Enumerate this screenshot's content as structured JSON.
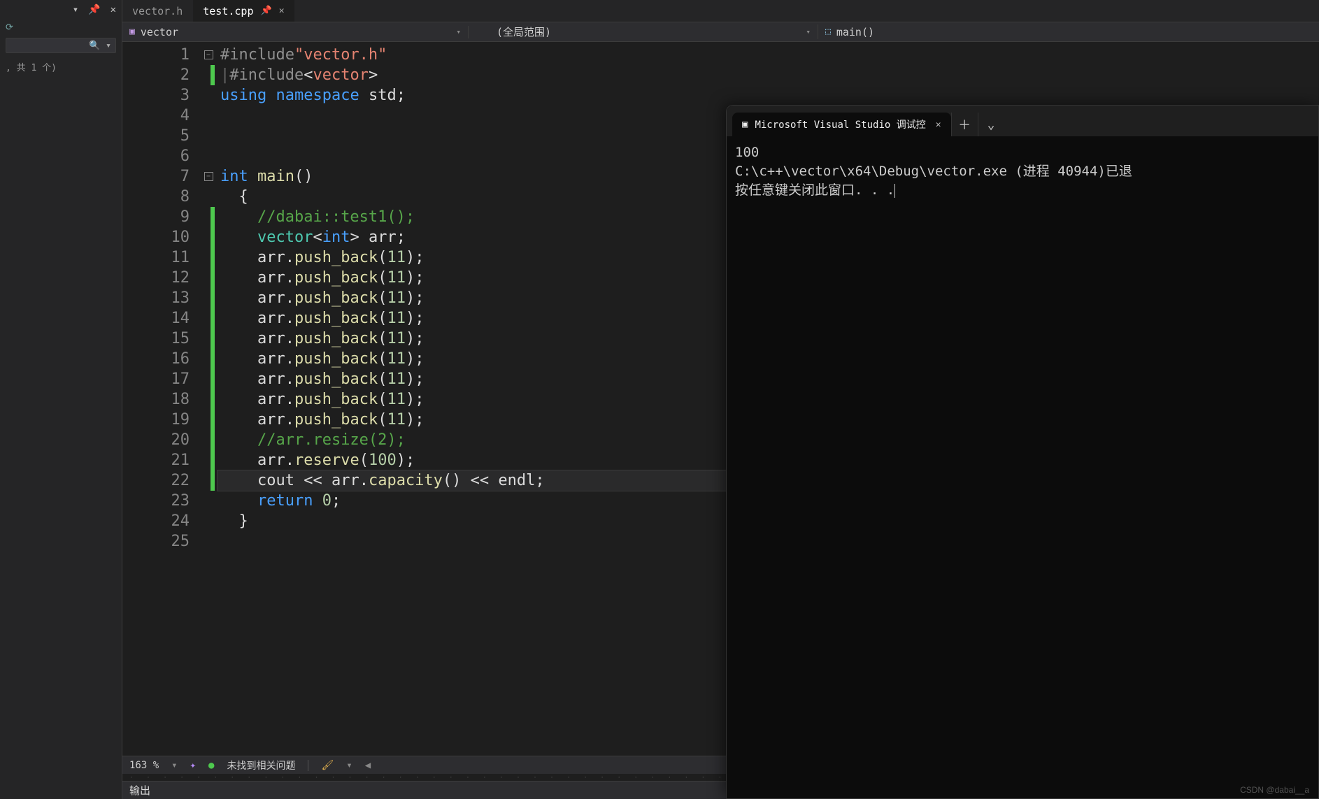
{
  "left_panel": {
    "hint": ", 共 1 个)",
    "top_icons": [
      "chev-down",
      "pin",
      "close"
    ]
  },
  "tabs": [
    {
      "label": "vector.h",
      "active": false
    },
    {
      "label": "test.cpp",
      "active": true
    }
  ],
  "nav": {
    "left": "vector",
    "middle": "(全局范围)",
    "right": "main()"
  },
  "code": {
    "lines": [
      {
        "n": 1,
        "fold": true,
        "green": false,
        "tokens": [
          [
            "pre",
            "#include"
          ],
          [
            "str",
            "\"vector.h\""
          ]
        ]
      },
      {
        "n": 2,
        "fold": false,
        "green": true,
        "tokens": [
          [
            "plainbar",
            "|"
          ],
          [
            "pre",
            "#include"
          ],
          [
            "punct",
            "<"
          ],
          [
            "str",
            "vector"
          ],
          [
            "punct",
            ">"
          ]
        ]
      },
      {
        "n": 3,
        "fold": false,
        "green": false,
        "tokens": [
          [
            "kw",
            "using"
          ],
          [
            "plain",
            " "
          ],
          [
            "kw",
            "namespace"
          ],
          [
            "plain",
            " "
          ],
          [
            "plain",
            "std"
          ],
          [
            "punct",
            ";"
          ]
        ]
      },
      {
        "n": 4,
        "fold": false,
        "green": false,
        "tokens": []
      },
      {
        "n": 5,
        "fold": false,
        "green": false,
        "tokens": []
      },
      {
        "n": 6,
        "fold": false,
        "green": false,
        "tokens": []
      },
      {
        "n": 7,
        "fold": true,
        "green": false,
        "tokens": [
          [
            "kw",
            "int"
          ],
          [
            "plain",
            " "
          ],
          [
            "fn",
            "main"
          ],
          [
            "punct",
            "()"
          ]
        ]
      },
      {
        "n": 8,
        "fold": false,
        "green": false,
        "indent": 1,
        "tokens": [
          [
            "punct",
            "{"
          ]
        ]
      },
      {
        "n": 9,
        "fold": false,
        "green": true,
        "indent": 2,
        "tokens": [
          [
            "cmt",
            "//dabai::test1();"
          ]
        ]
      },
      {
        "n": 10,
        "fold": false,
        "green": true,
        "indent": 2,
        "tokens": [
          [
            "type",
            "vector"
          ],
          [
            "punct",
            "<"
          ],
          [
            "kw",
            "int"
          ],
          [
            "punct",
            "> "
          ],
          [
            "plain",
            "arr"
          ],
          [
            "punct",
            ";"
          ]
        ]
      },
      {
        "n": 11,
        "fold": false,
        "green": true,
        "indent": 2,
        "tokens": [
          [
            "plain",
            "arr"
          ],
          [
            "punct",
            "."
          ],
          [
            "fn",
            "push_back"
          ],
          [
            "punct",
            "("
          ],
          [
            "num",
            "11"
          ],
          [
            "punct",
            ");"
          ]
        ]
      },
      {
        "n": 12,
        "fold": false,
        "green": true,
        "indent": 2,
        "tokens": [
          [
            "plain",
            "arr"
          ],
          [
            "punct",
            "."
          ],
          [
            "fn",
            "push_back"
          ],
          [
            "punct",
            "("
          ],
          [
            "num",
            "11"
          ],
          [
            "punct",
            ");"
          ]
        ]
      },
      {
        "n": 13,
        "fold": false,
        "green": true,
        "indent": 2,
        "tokens": [
          [
            "plain",
            "arr"
          ],
          [
            "punct",
            "."
          ],
          [
            "fn",
            "push_back"
          ],
          [
            "punct",
            "("
          ],
          [
            "num",
            "11"
          ],
          [
            "punct",
            ");"
          ]
        ]
      },
      {
        "n": 14,
        "fold": false,
        "green": true,
        "indent": 2,
        "tokens": [
          [
            "plain",
            "arr"
          ],
          [
            "punct",
            "."
          ],
          [
            "fn",
            "push_back"
          ],
          [
            "punct",
            "("
          ],
          [
            "num",
            "11"
          ],
          [
            "punct",
            ");"
          ]
        ]
      },
      {
        "n": 15,
        "fold": false,
        "green": true,
        "indent": 2,
        "tokens": [
          [
            "plain",
            "arr"
          ],
          [
            "punct",
            "."
          ],
          [
            "fn",
            "push_back"
          ],
          [
            "punct",
            "("
          ],
          [
            "num",
            "11"
          ],
          [
            "punct",
            ");"
          ]
        ]
      },
      {
        "n": 16,
        "fold": false,
        "green": true,
        "indent": 2,
        "tokens": [
          [
            "plain",
            "arr"
          ],
          [
            "punct",
            "."
          ],
          [
            "fn",
            "push_back"
          ],
          [
            "punct",
            "("
          ],
          [
            "num",
            "11"
          ],
          [
            "punct",
            ");"
          ]
        ]
      },
      {
        "n": 17,
        "fold": false,
        "green": true,
        "indent": 2,
        "tokens": [
          [
            "plain",
            "arr"
          ],
          [
            "punct",
            "."
          ],
          [
            "fn",
            "push_back"
          ],
          [
            "punct",
            "("
          ],
          [
            "num",
            "11"
          ],
          [
            "punct",
            ");"
          ]
        ]
      },
      {
        "n": 18,
        "fold": false,
        "green": true,
        "indent": 2,
        "tokens": [
          [
            "plain",
            "arr"
          ],
          [
            "punct",
            "."
          ],
          [
            "fn",
            "push_back"
          ],
          [
            "punct",
            "("
          ],
          [
            "num",
            "11"
          ],
          [
            "punct",
            ");"
          ]
        ]
      },
      {
        "n": 19,
        "fold": false,
        "green": true,
        "indent": 2,
        "tokens": [
          [
            "plain",
            "arr"
          ],
          [
            "punct",
            "."
          ],
          [
            "fn",
            "push_back"
          ],
          [
            "punct",
            "("
          ],
          [
            "num",
            "11"
          ],
          [
            "punct",
            ");"
          ]
        ]
      },
      {
        "n": 20,
        "fold": false,
        "green": true,
        "indent": 2,
        "tokens": [
          [
            "cmt",
            "//arr.resize(2);"
          ]
        ]
      },
      {
        "n": 21,
        "fold": false,
        "green": true,
        "indent": 2,
        "tokens": [
          [
            "plain",
            "arr"
          ],
          [
            "punct",
            "."
          ],
          [
            "fn",
            "reserve"
          ],
          [
            "punct",
            "("
          ],
          [
            "num",
            "100"
          ],
          [
            "punct",
            ");"
          ]
        ]
      },
      {
        "n": 22,
        "fold": false,
        "green": true,
        "indent": 2,
        "current": true,
        "tokens": [
          [
            "plain",
            "cout"
          ],
          [
            "punct",
            " << "
          ],
          [
            "plain",
            "arr"
          ],
          [
            "punct",
            "."
          ],
          [
            "fn",
            "capacity"
          ],
          [
            "punct",
            "() << "
          ],
          [
            "plain",
            "endl"
          ],
          [
            "punct",
            ";"
          ]
        ]
      },
      {
        "n": 23,
        "fold": false,
        "green": false,
        "indent": 2,
        "tokens": [
          [
            "kw",
            "return"
          ],
          [
            "plain",
            " "
          ],
          [
            "num",
            "0"
          ],
          [
            "punct",
            ";"
          ]
        ]
      },
      {
        "n": 24,
        "fold": false,
        "green": false,
        "indent": 1,
        "tokens": [
          [
            "punct",
            "}"
          ]
        ]
      },
      {
        "n": 25,
        "fold": false,
        "green": false,
        "tokens": []
      }
    ]
  },
  "statusbar": {
    "zoom": "163 %",
    "issues": "未找到相关问题"
  },
  "output_label": "输出",
  "terminal": {
    "title": "Microsoft Visual Studio 调试控",
    "lines": [
      "100",
      "",
      "C:\\c++\\vector\\x64\\Debug\\vector.exe (进程 40944)已退",
      "按任意键关闭此窗口. . ."
    ]
  },
  "watermark": "CSDN @dabai__a"
}
